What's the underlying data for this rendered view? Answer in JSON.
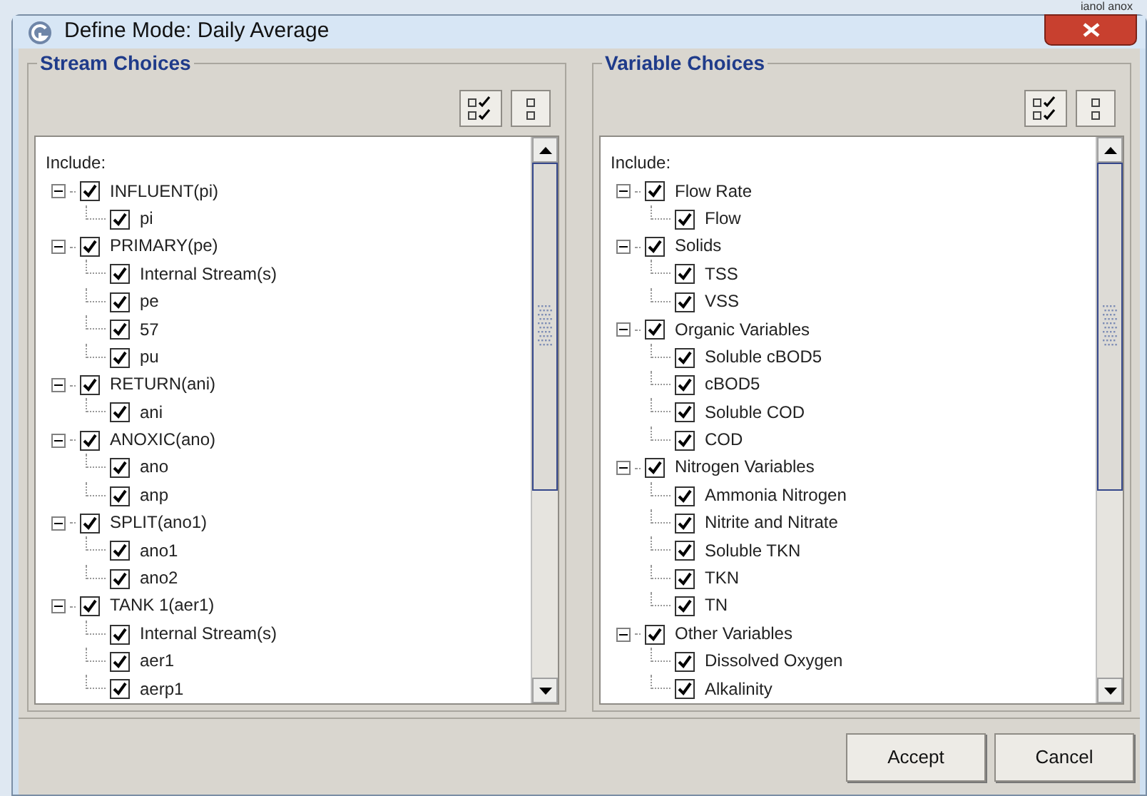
{
  "background_text": "ianol anox",
  "window": {
    "title": "Define Mode: Daily Average"
  },
  "panels": [
    {
      "title": "Stream Choices",
      "tree_label": "Include:",
      "items": [
        {
          "label": "INFLUENT(pi)",
          "checked": true,
          "expanded": true,
          "children": [
            {
              "label": "pi",
              "checked": true
            }
          ]
        },
        {
          "label": "PRIMARY(pe)",
          "checked": true,
          "expanded": true,
          "children": [
            {
              "label": "Internal Stream(s)",
              "checked": true
            },
            {
              "label": "pe",
              "checked": true
            },
            {
              "label": "57",
              "checked": true
            },
            {
              "label": "pu",
              "checked": true
            }
          ]
        },
        {
          "label": "RETURN(ani)",
          "checked": true,
          "expanded": true,
          "children": [
            {
              "label": "ani",
              "checked": true
            }
          ]
        },
        {
          "label": "ANOXIC(ano)",
          "checked": true,
          "expanded": true,
          "children": [
            {
              "label": "ano",
              "checked": true
            },
            {
              "label": "anp",
              "checked": true
            }
          ]
        },
        {
          "label": "SPLIT(ano1)",
          "checked": true,
          "expanded": true,
          "children": [
            {
              "label": "ano1",
              "checked": true
            },
            {
              "label": "ano2",
              "checked": true
            }
          ]
        },
        {
          "label": "TANK 1(aer1)",
          "checked": true,
          "expanded": true,
          "children": [
            {
              "label": "Internal Stream(s)",
              "checked": true
            },
            {
              "label": "aer1",
              "checked": true
            },
            {
              "label": "aerp1",
              "checked": true
            }
          ]
        }
      ]
    },
    {
      "title": "Variable Choices",
      "tree_label": "Include:",
      "items": [
        {
          "label": "Flow Rate",
          "checked": true,
          "expanded": true,
          "children": [
            {
              "label": "Flow",
              "checked": true
            }
          ]
        },
        {
          "label": "Solids",
          "checked": true,
          "expanded": true,
          "children": [
            {
              "label": "TSS",
              "checked": true
            },
            {
              "label": "VSS",
              "checked": true
            }
          ]
        },
        {
          "label": "Organic Variables",
          "checked": true,
          "expanded": true,
          "children": [
            {
              "label": "Soluble cBOD5",
              "checked": true
            },
            {
              "label": "cBOD5",
              "checked": true
            },
            {
              "label": "Soluble COD",
              "checked": true
            },
            {
              "label": "COD",
              "checked": true
            }
          ]
        },
        {
          "label": "Nitrogen Variables",
          "checked": true,
          "expanded": true,
          "children": [
            {
              "label": "Ammonia Nitrogen",
              "checked": true
            },
            {
              "label": "Nitrite and Nitrate",
              "checked": true
            },
            {
              "label": "Soluble TKN",
              "checked": true
            },
            {
              "label": "TKN",
              "checked": true
            },
            {
              "label": "TN",
              "checked": true
            }
          ]
        },
        {
          "label": "Other Variables",
          "checked": true,
          "expanded": true,
          "children": [
            {
              "label": "Dissolved Oxygen",
              "checked": true
            },
            {
              "label": "Alkalinity",
              "checked": true
            }
          ]
        }
      ]
    }
  ],
  "buttons": [
    "Accept",
    "Cancel"
  ]
}
